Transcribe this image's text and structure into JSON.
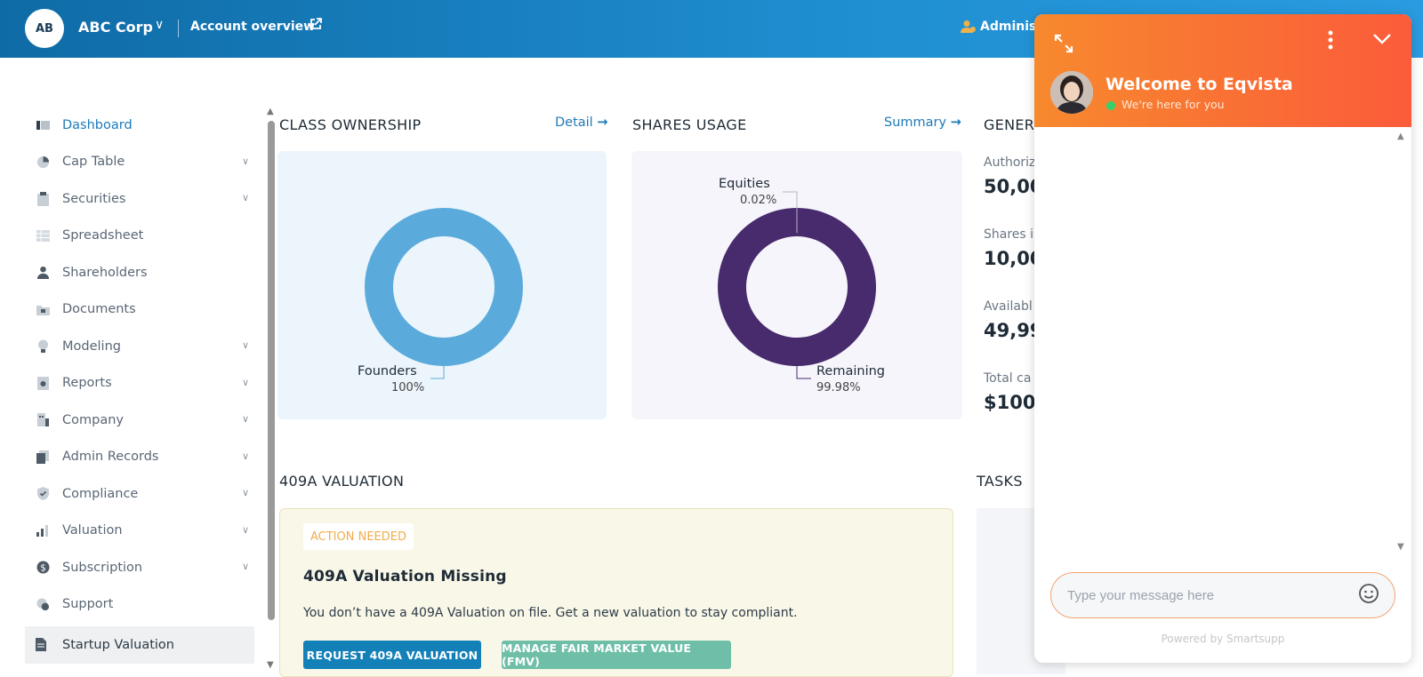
{
  "header": {
    "avatar_initials": "AB",
    "company": "ABC Corp",
    "account_link": "Account overview",
    "admin_label": "Administ"
  },
  "sidebar": {
    "items": [
      {
        "label": "Dashboard",
        "icon": "dashboard-icon",
        "has_chevron": false,
        "active": true
      },
      {
        "label": "Cap Table",
        "icon": "pie-chart-icon",
        "has_chevron": true
      },
      {
        "label": "Securities",
        "icon": "clipboard-icon",
        "has_chevron": true
      },
      {
        "label": "Spreadsheet",
        "icon": "spreadsheet-icon",
        "has_chevron": false
      },
      {
        "label": "Shareholders",
        "icon": "person-icon",
        "has_chevron": false
      },
      {
        "label": "Documents",
        "icon": "folder-icon",
        "has_chevron": false
      },
      {
        "label": "Modeling",
        "icon": "lightbulb-icon",
        "has_chevron": true
      },
      {
        "label": "Reports",
        "icon": "report-icon",
        "has_chevron": true
      },
      {
        "label": "Company",
        "icon": "building-icon",
        "has_chevron": true
      },
      {
        "label": "Admin Records",
        "icon": "records-icon",
        "has_chevron": true
      },
      {
        "label": "Compliance",
        "icon": "shield-icon",
        "has_chevron": true
      },
      {
        "label": "Valuation",
        "icon": "chart-icon",
        "has_chevron": true
      },
      {
        "label": "Subscription",
        "icon": "dollar-icon",
        "has_chevron": true
      },
      {
        "label": "Support",
        "icon": "support-icon",
        "has_chevron": false
      }
    ],
    "startup_valuation": "Startup Valuation"
  },
  "class_ownership": {
    "title": "CLASS OWNERSHIP",
    "link": "Detail",
    "chart_data": {
      "type": "pie",
      "categories": [
        "Founders"
      ],
      "values": [
        100
      ],
      "labels": [
        "100%"
      ],
      "colors": [
        "#5aabdc"
      ]
    }
  },
  "shares_usage": {
    "title": "SHARES USAGE",
    "link": "Summary",
    "chart_data": {
      "type": "pie",
      "categories": [
        "Equities",
        "Remaining"
      ],
      "values": [
        0.02,
        99.98
      ],
      "labels": [
        "0.02%",
        "99.98%"
      ],
      "colors": [
        "#4a2b6e",
        "#472b6c"
      ]
    }
  },
  "general": {
    "title": "GENER",
    "stats": [
      {
        "label": "Authoriz",
        "value": "50,00"
      },
      {
        "label": "Shares i",
        "value": "10,00"
      },
      {
        "label": "Availabl",
        "value": "49,99"
      },
      {
        "label": "Total ca",
        "value": "$100"
      }
    ]
  },
  "valuation_409a": {
    "title": "409A VALUATION",
    "badge": "ACTION NEEDED",
    "heading": "409A Valuation Missing",
    "text": "You don’t have a 409A Valuation on file. Get a new valuation to stay compliant.",
    "primary_button": "REQUEST 409A VALUATION",
    "secondary_button": "MANAGE FAIR MARKET VALUE (FMV)"
  },
  "tasks": {
    "title": "TASKS"
  },
  "chat": {
    "title": "Welcome to Eqvista",
    "status": "We're here for you",
    "input_placeholder": "Type your message here",
    "powered_by": "Powered by Smartsupp",
    "colors": {
      "header_start": "#f7892e",
      "header_end": "#fb5b3a",
      "online": "#32d26b"
    }
  }
}
